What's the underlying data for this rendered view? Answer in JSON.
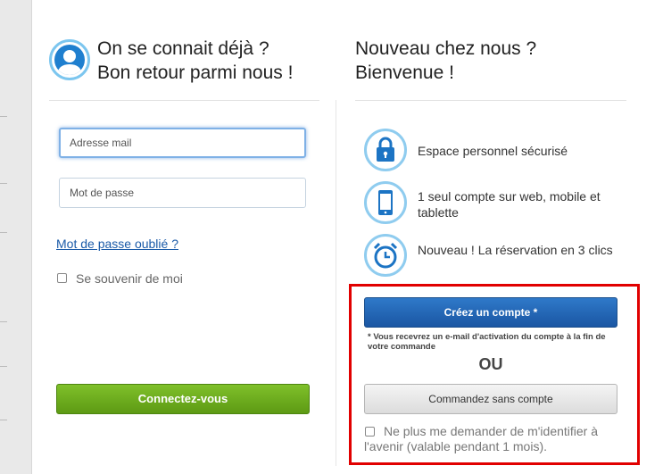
{
  "login": {
    "title_line1": "On se connait déjà ?",
    "title_line2": "Bon retour parmi nous !",
    "email_placeholder": "Adresse mail",
    "password_placeholder": "Mot de passe",
    "forgot_link": "Mot de passe oublié ?",
    "remember_label": "Se souvenir de moi",
    "submit_label": "Connectez-vous",
    "icon": "user-avatar-icon"
  },
  "register": {
    "title_line1": "Nouveau chez nous ?",
    "title_line2": "Bienvenue !",
    "features": [
      {
        "icon": "padlock-icon",
        "text": "Espace personnel sécurisé"
      },
      {
        "icon": "mobile-phone-icon",
        "text": "1 seul compte sur web, mobile et tablette"
      },
      {
        "icon": "alarm-clock-icon",
        "text": "Nouveau ! La réservation en 3 clics"
      }
    ],
    "create_button": "Créez un compte *",
    "create_note": "* Vous recevrez un e-mail d'activation du compte à la fin de votre commande",
    "or_label": "OU",
    "guest_button": "Commandez sans compte",
    "dont_ask_label": "Ne plus me demander de m'identifier à l'avenir (valable pendant 1 mois)."
  },
  "colors": {
    "primary_blue": "#1a56a3",
    "success_green": "#6aaa1c",
    "icon_ring": "#8fccef",
    "highlight_red": "#e10000"
  }
}
